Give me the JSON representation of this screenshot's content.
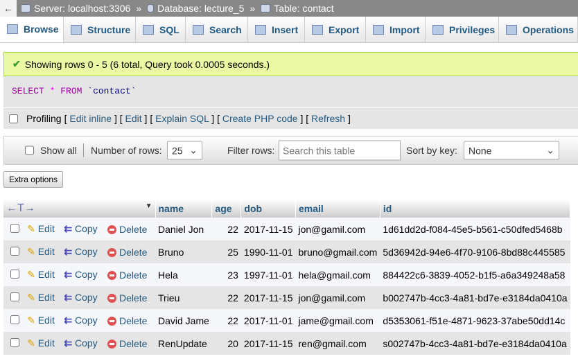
{
  "breadcrumb": {
    "back": "←",
    "server": "Server: localhost:3306",
    "database": "Database: lecture_5",
    "table": "Table: contact",
    "separator": "»"
  },
  "tabs": [
    {
      "label": "Browse",
      "icon": "browse-icon"
    },
    {
      "label": "Structure",
      "icon": "structure-icon"
    },
    {
      "label": "SQL",
      "icon": "sql-icon"
    },
    {
      "label": "Search",
      "icon": "search-icon"
    },
    {
      "label": "Insert",
      "icon": "insert-icon"
    },
    {
      "label": "Export",
      "icon": "export-icon"
    },
    {
      "label": "Import",
      "icon": "import-icon"
    },
    {
      "label": "Privileges",
      "icon": "privileges-icon"
    },
    {
      "label": "Operations",
      "icon": "wrench-icon"
    }
  ],
  "message": "Showing rows 0 - 5 (6 total, Query took 0.0005 seconds.)",
  "sql": {
    "select": "SELECT",
    "star": "*",
    "from": "FROM",
    "table": "`contact`"
  },
  "profiling": {
    "label": "Profiling",
    "links": [
      "Edit inline",
      "Edit",
      "Explain SQL",
      "Create PHP code",
      "Refresh"
    ]
  },
  "nav": {
    "show_all": "Show all",
    "rows_label": "Number of rows:",
    "rows_value": "25",
    "filter_label": "Filter rows:",
    "filter_placeholder": "Search this table",
    "sort_label": "Sort by key:",
    "sort_value": "None"
  },
  "extra_options": "Extra options",
  "table": {
    "columns": [
      "name",
      "age",
      "dob",
      "email",
      "id"
    ],
    "actions": {
      "edit": "Edit",
      "copy": "Copy",
      "delete": "Delete"
    },
    "rows": [
      [
        "Daniel Jon",
        "22",
        "2017-11-15",
        "jon@gamil.com",
        "1d61dd2d-f084-45e5-b561-c50dfed5468b"
      ],
      [
        "Bruno",
        "25",
        "1990-11-01",
        "bruno@gmail.com",
        "5d36942d-94e6-4f70-9106-8bd88c445585"
      ],
      [
        "Hela",
        "23",
        "1997-11-01",
        "hela@gmail.com",
        "884422c6-3839-4052-b1f5-a6a349248a58"
      ],
      [
        "Trieu",
        "22",
        "2017-11-15",
        "jon@gamil.com",
        "b002747b-4cc3-4a81-bd7e-e3184da0410a"
      ],
      [
        "David Jame",
        "22",
        "2017-11-01",
        "jame@gmail.com",
        "d5353061-f51e-4871-9623-37abe50dd14c"
      ],
      [
        "RenUpdate",
        "20",
        "2017-11-15",
        "ren@gmail.com",
        "s002747b-4cc3-4a81-bd7e-e3184da0410a"
      ]
    ]
  }
}
